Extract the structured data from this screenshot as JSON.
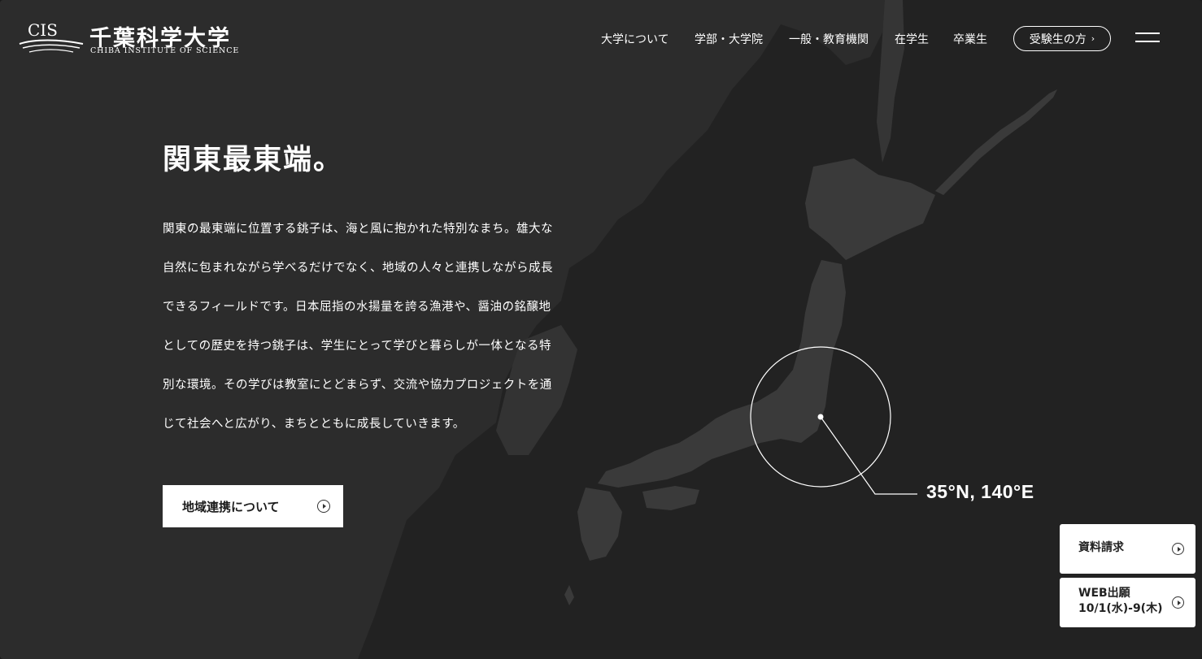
{
  "brand": {
    "logo_mark": "CIS",
    "name": "千葉科学大学",
    "name_en": "CHIBA INSTITUTE OF SCIENCE"
  },
  "nav": {
    "items": [
      {
        "label": "大学について"
      },
      {
        "label": "学部・大学院"
      },
      {
        "label": "一般・教育機関"
      },
      {
        "label": "在学生"
      },
      {
        "label": "卒業生"
      }
    ],
    "cta_label": "受験生の方",
    "cta_icon": "chevron-right-icon",
    "menu_icon": "hamburger-menu-icon"
  },
  "main": {
    "headline": "関東最東端。",
    "paragraph_lines": [
      "関東の最東端に位置する銚子は、海と風に抱かれた特別なまち。雄大な",
      "自然に包まれながら学べるだけでなく、地域の人々と連携しながら成長",
      "できるフィールドです。日本屈指の水揚量を誇る漁港や、醤油の銘醸地",
      "としての歴史を持つ銚子は、学生にとって学びと暮らしが一体となる特",
      "別な環境。その学びは教室にとどまらず、交流や協力プロジェクトを通",
      "じて社会へと広がり、まちとともに成長していきます。"
    ],
    "cta_label": "地域連携について"
  },
  "map": {
    "coordinates": "35°N, 140°E"
  },
  "side": {
    "brochure_label": "資料請求",
    "web_apply_line1": "WEB出願",
    "web_apply_line2": "10/1(水)-9(木)"
  },
  "colors": {
    "background": "#222222",
    "land": "#2f2f2f",
    "japan_land": "#383838",
    "text": "#ffffff",
    "button_bg": "#ffffff"
  }
}
